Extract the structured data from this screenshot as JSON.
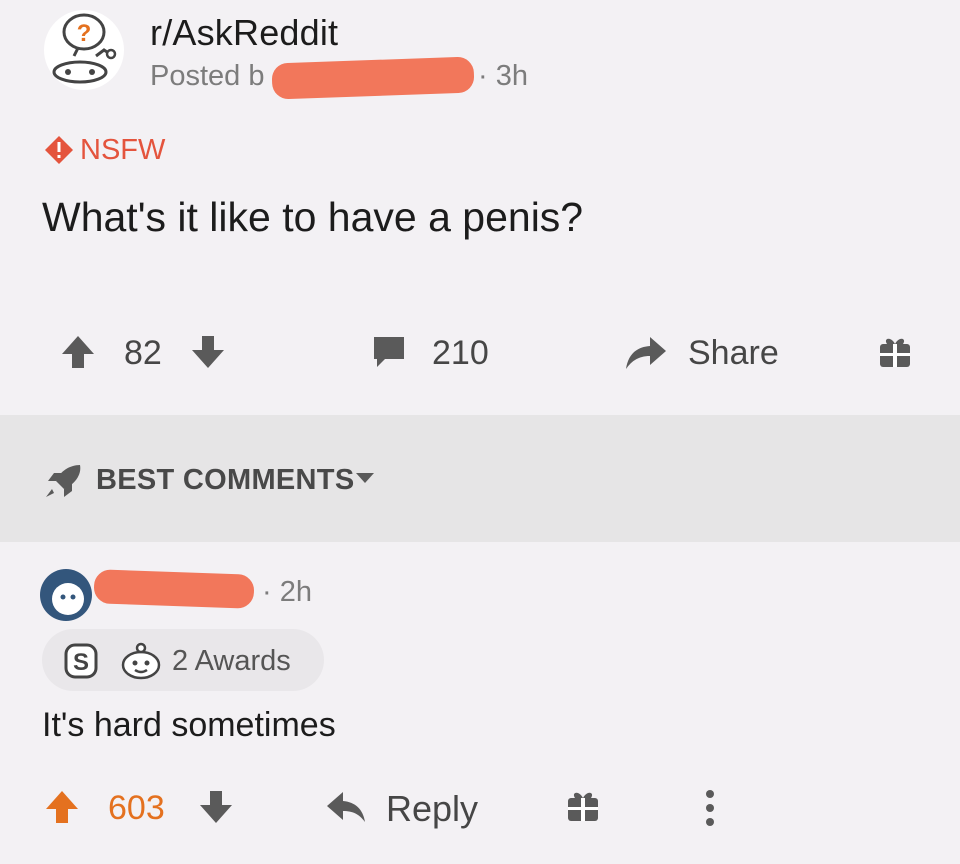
{
  "post": {
    "subreddit": "r/AskReddit",
    "posted_by_prefix": "Posted b",
    "time": "· 3h",
    "nsfw_label": "NSFW",
    "title": "What's it like to have a penis?",
    "score": "82",
    "comment_count": "210",
    "share_label": "Share"
  },
  "sort": {
    "label": "BEST COMMENTS"
  },
  "comment": {
    "time": "· 2h",
    "awards_label": "2 Awards",
    "body": "It's hard sometimes",
    "score": "603",
    "reply_label": "Reply"
  },
  "colors": {
    "background": "#f3f1f4",
    "sort_band": "#e6e5e6",
    "nsfw": "#e4543d",
    "upvoted": "#e4711f",
    "redaction": "#f2775b",
    "meta_text": "#7c7c7c"
  },
  "icons": {
    "subreddit": "askreddit-snoo-icon",
    "nsfw": "nsfw-diamond-icon",
    "upvote": "upvote-arrow-icon",
    "downvote": "downvote-arrow-icon",
    "comments": "comment-bubble-icon",
    "share": "share-arrow-icon",
    "award": "gift-icon",
    "sort": "rocket-icon",
    "reply": "reply-arrow-icon",
    "more": "more-vertical-icon"
  }
}
